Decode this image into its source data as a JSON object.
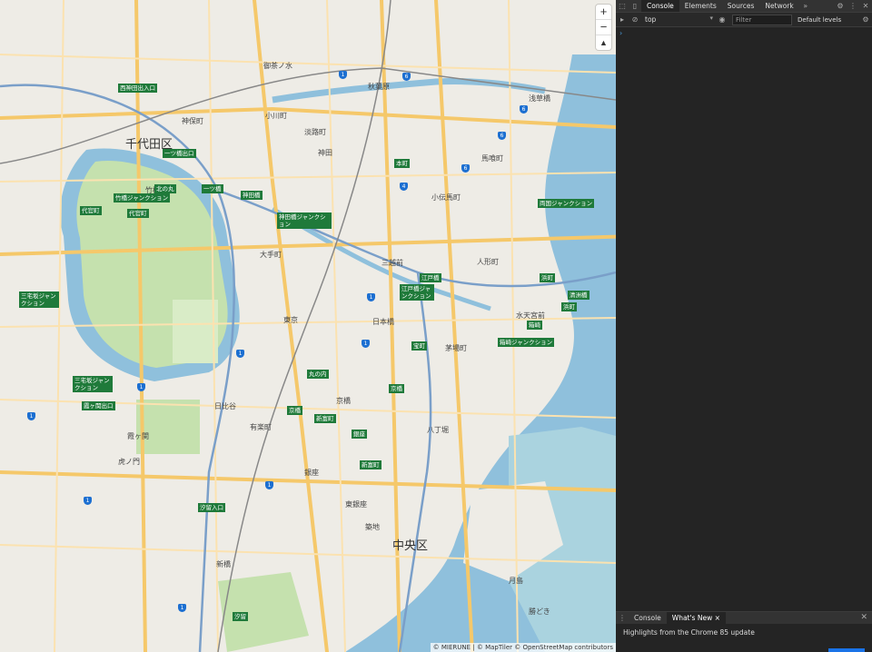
{
  "map": {
    "wards": {
      "chiyoda": "千代田区",
      "chuo": "中央区"
    },
    "junctions": [
      "西神田出入口",
      "一ツ橋出口",
      "北の丸",
      "一ツ橋",
      "竹橋ジャンクション",
      "代官町",
      "代官町",
      "神田橋",
      "神田橋ジャンクション",
      "三宅坂ジャンクション",
      "江戸橋",
      "江戸橋ジャンクション",
      "霞ヶ関出口",
      "三宅坂ジャンクション",
      "丸の内",
      "宝町",
      "京橋",
      "京橋",
      "新富町",
      "銀座",
      "新富町",
      "汐留",
      "汐留入口",
      "浜町",
      "両国ジャンクション",
      "浜町",
      "清洲橋",
      "箱崎ジャンクション",
      "箱崎",
      "本町"
    ],
    "places": {
      "kanda": "神田",
      "ogawamachi": "小川町",
      "jimbocho": "神保町",
      "ochanomizu": "御茶ノ水",
      "akihabara": "秋葉原",
      "asakusabashi": "浅草橋",
      "bakurocho": "馬喰町",
      "awajicho": "淡路町",
      "otemachi": "大手町",
      "nihonbashi": "日本橋",
      "mitsukoshimae": "三越前",
      "kayabacho": "茅場町",
      "hatchobori": "八丁堀",
      "tokyo": "東京",
      "yurakucho": "有楽町",
      "hibiya": "日比谷",
      "ginza": "銀座",
      "higashiginza": "東銀座",
      "shimbashi": "新橋",
      "kyobashi": "京橋",
      "toranomon": "虎ノ門",
      "kasumigaseki": "霞ヶ関",
      "ningyocho": "人形町",
      "suitengumae": "水天宮前",
      "tsukiji": "築地",
      "kachidoki": "勝どき",
      "tsukishima": "月島",
      "takebashi": "竹橋",
      "ningyocho2": "小伝馬町",
      "kodenmacho": "小伝馬町",
      "shintomicho": "新富町"
    },
    "zoom_in": "+",
    "zoom_out": "−",
    "compass": "▲",
    "attribution": "© MIERUNE | © MapTiler © OpenStreetMap contributors"
  },
  "devtools": {
    "tabs": [
      "Console",
      "Elements",
      "Sources",
      "Network"
    ],
    "active_tab": "Console",
    "more": "»",
    "context": "top",
    "filter_placeholder": "Filter",
    "levels": "Default levels",
    "prompt": "›",
    "drawer_tabs": [
      "Console",
      "What's New"
    ],
    "drawer_text": "Highlights from the Chrome 85 update"
  },
  "colors": {
    "water": "#aad3df",
    "park": "#c8e6b0",
    "road_major": "#f8d690",
    "devtools_bg": "#242424"
  }
}
